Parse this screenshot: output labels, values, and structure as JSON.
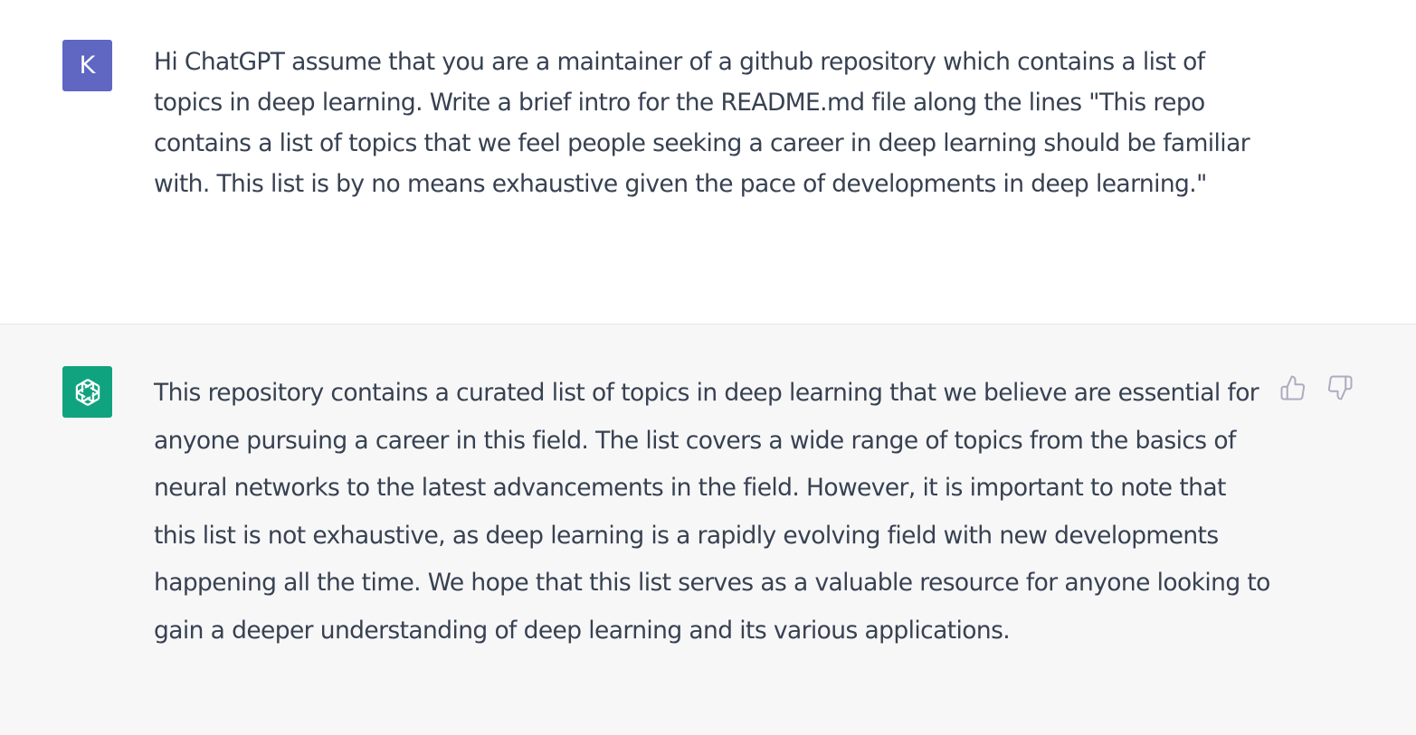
{
  "user_message": {
    "avatar_letter": "K",
    "avatar_color": "#5f67c2",
    "text": "Hi ChatGPT assume that you are a maintainer of a github repository which contains a list of topics in deep learning. Write a brief intro for the README.md file along the lines \"This repo contains a list of topics that we feel people seeking a career in deep learning should be familiar with. This list is by no means exhaustive given the pace of developments in deep learning.\""
  },
  "assistant_message": {
    "avatar_icon": "openai-logo-icon",
    "avatar_color": "#10a37f",
    "text": "This repository contains a curated list of topics in deep learning that we believe are essential for anyone pursuing a career in this field. The list covers a wide range of topics from the basics of neural networks to the latest advancements in the field. However, it is important to note that this list is not exhaustive, as deep learning is a rapidly evolving field with new developments happening all the time. We hope that this list serves as a valuable resource for anyone looking to gain a deeper understanding of deep learning and its various applications.",
    "feedback": {
      "thumbs_up_icon": "thumbs-up-icon",
      "thumbs_down_icon": "thumbs-down-icon"
    }
  }
}
